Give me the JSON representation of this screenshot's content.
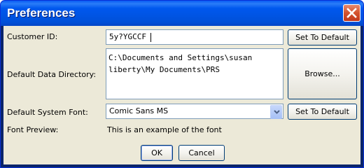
{
  "window": {
    "title": "Preferences"
  },
  "customer_id": {
    "label": "Customer ID:",
    "value": "5y?YGCCF",
    "default_button": "Set To Default"
  },
  "data_directory": {
    "label": "Default Data Directory:",
    "line1": "C:\\Documents and Settings\\susan",
    "line2": "liberty\\My Documents\\PRS",
    "browse_button": "Browse..."
  },
  "system_font": {
    "label": "Default System Font:",
    "selected": "Comic Sans MS",
    "default_button": "Set To Default"
  },
  "font_preview": {
    "label": "Font Preview:",
    "text": "This is an example of the font"
  },
  "actions": {
    "ok": "OK",
    "cancel": "Cancel"
  },
  "colors": {
    "titlebar": "#0054e3",
    "dialog_bg": "#ece9d8",
    "close": "#d4522d",
    "field_border": "#7f9db9"
  },
  "icons": {
    "close": "close-icon",
    "dropdown": "chevron-down-icon"
  }
}
